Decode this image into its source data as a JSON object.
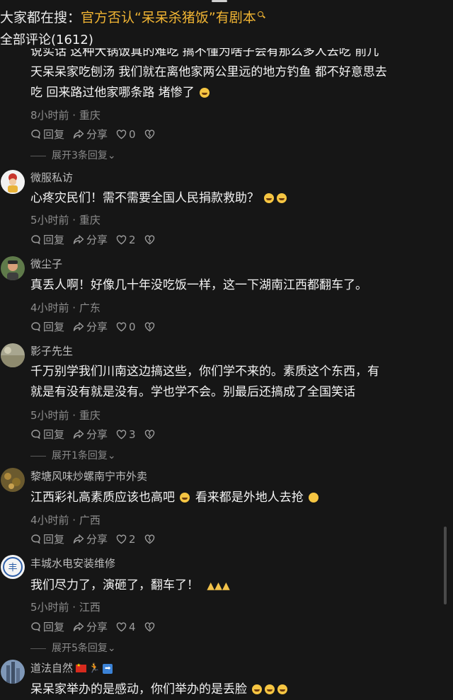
{
  "search": {
    "prefix": "大家都在搜：",
    "term": "官方否认“呆呆杀猪饭”有剧本"
  },
  "comments_header": "全部评论(1612)",
  "actions": {
    "reply": "回复",
    "share": "分享"
  },
  "comments": [
    {
      "user": "",
      "lines": [
        "说实话 这种大锅饭真的难吃 搞不懂为啥子会有那么多人去吃 前几",
        "天呆呆家吃刨汤 我们就在离他家两公里远的地方钓鱼 都不好意思去",
        "吃 回来路过他家哪条路 堵惨了"
      ],
      "time": "8小时前 · 重庆",
      "likes": "0",
      "expand": "展开3条回复"
    },
    {
      "user": "微服私访",
      "lines": [
        "心疼灾民们！需不需要全国人民捐款救助？"
      ],
      "time": "5小时前 · 重庆",
      "likes": "2",
      "expand": ""
    },
    {
      "user": "微尘子",
      "lines": [
        "真丢人啊！好像几十年没吃饭一样，这一下湖南江西都翻车了。"
      ],
      "time": "4小时前 · 广东",
      "likes": "0",
      "expand": ""
    },
    {
      "user": "影子先生",
      "lines": [
        "千万别学我们川南这边搞这些，你们学不来的。素质这个东西，有",
        "就是有没有就是没有。学也学不会。别最后还搞成了全国笑话"
      ],
      "time": "5小时前 · 重庆",
      "likes": "3",
      "expand": "展开1条回复"
    },
    {
      "user": "黎塘风味炒螺南宁市外卖",
      "lines": [
        "江西彩礼高素质应该也高吧",
        "看来都是外地人去抢"
      ],
      "time": "4小时前 · 广西",
      "likes": "2",
      "expand": ""
    },
    {
      "user": "丰城水电安装维修",
      "lines": [
        "我们尽力了，演砸了，翻车了！"
      ],
      "time": "5小时前 · 江西",
      "likes": "4",
      "expand": "展开5条回复"
    },
    {
      "user": "道法自然",
      "lines": [
        "呆呆家举办的是感动，你们举办的是丢脸"
      ],
      "time": "",
      "likes": "",
      "expand": ""
    }
  ]
}
